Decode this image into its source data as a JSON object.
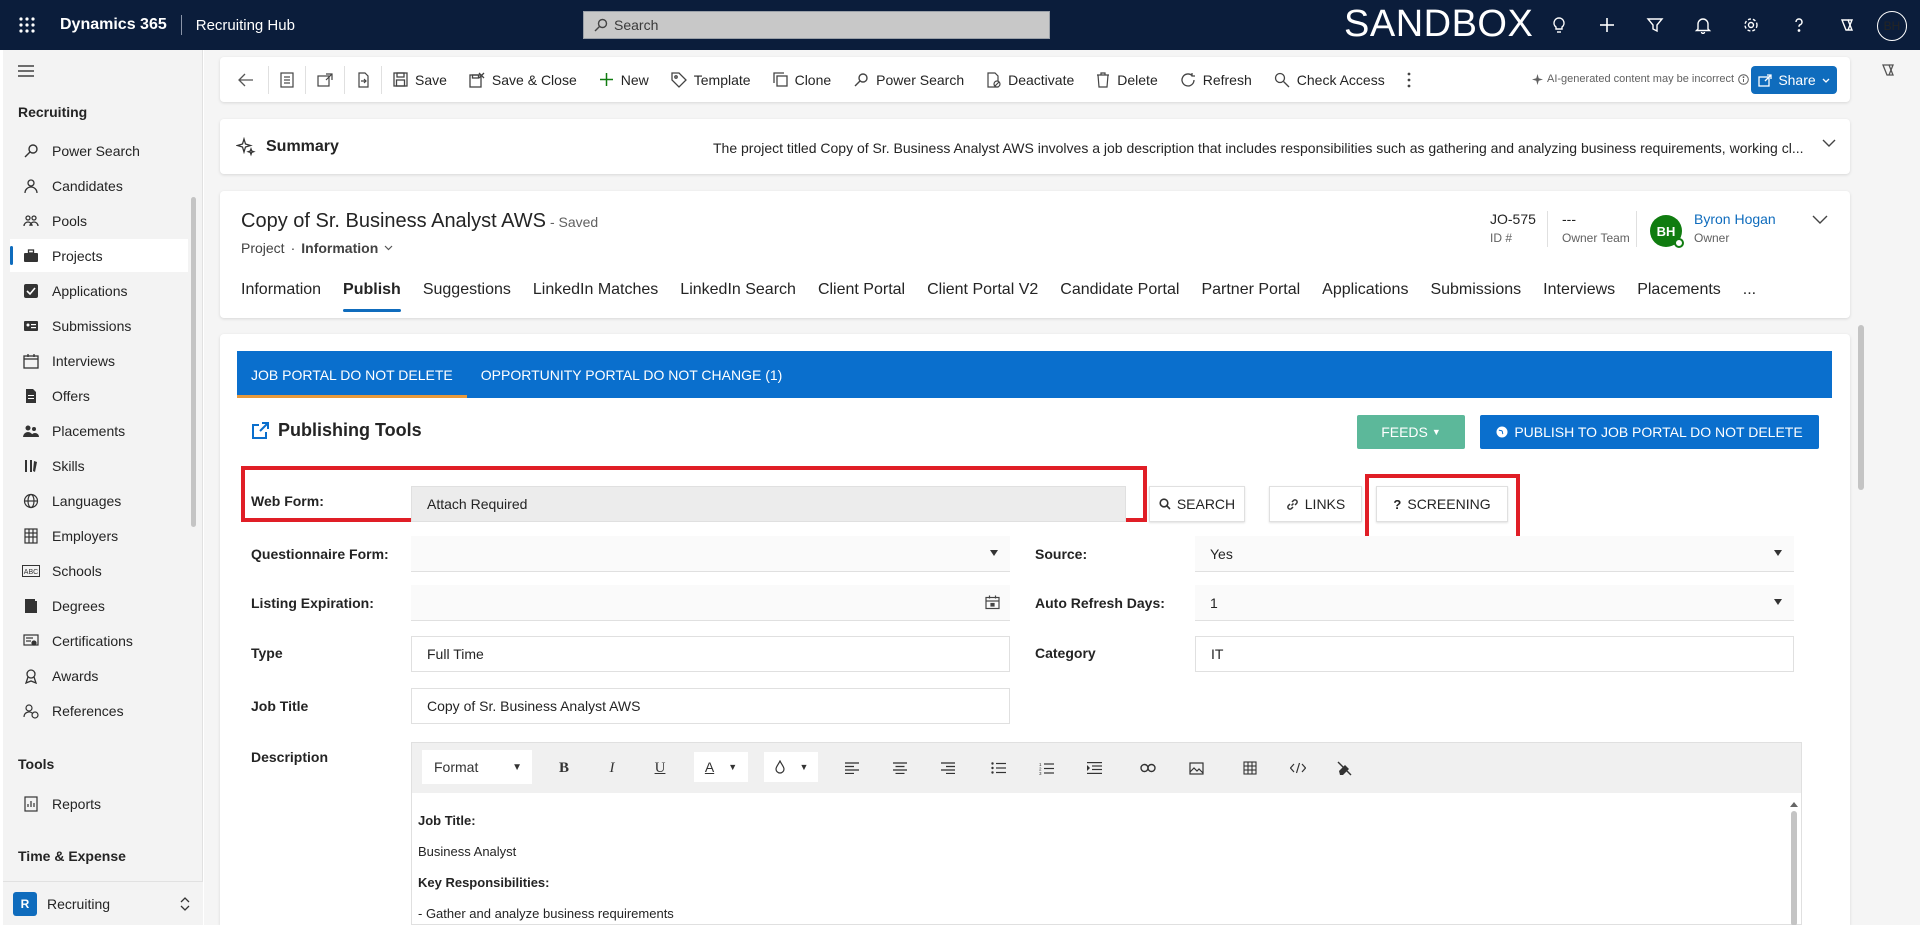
{
  "topbar": {
    "app_name": "Dynamics 365",
    "hub_name": "Recruiting Hub",
    "search_placeholder": "Search",
    "environment_banner": "SANDBOX",
    "user_initials": "BH"
  },
  "sidebar": {
    "section_recruiting": "Recruiting",
    "items": [
      {
        "label": "Power Search",
        "icon": "power-search-icon"
      },
      {
        "label": "Candidates",
        "icon": "person-icon"
      },
      {
        "label": "Pools",
        "icon": "people-group-icon"
      },
      {
        "label": "Projects",
        "icon": "briefcase-icon",
        "active": true
      },
      {
        "label": "Applications",
        "icon": "checkbox-icon"
      },
      {
        "label": "Submissions",
        "icon": "id-card-icon"
      },
      {
        "label": "Interviews",
        "icon": "calendar-icon"
      },
      {
        "label": "Offers",
        "icon": "document-icon"
      },
      {
        "label": "Placements",
        "icon": "people-icon"
      },
      {
        "label": "Skills",
        "icon": "skills-icon"
      },
      {
        "label": "Languages",
        "icon": "globe-icon"
      },
      {
        "label": "Employers",
        "icon": "building-icon"
      },
      {
        "label": "Schools",
        "icon": "abc-icon"
      },
      {
        "label": "Degrees",
        "icon": "book-icon"
      },
      {
        "label": "Certifications",
        "icon": "certificate-icon"
      },
      {
        "label": "Awards",
        "icon": "award-icon"
      },
      {
        "label": "References",
        "icon": "references-icon"
      }
    ],
    "section_tools": "Tools",
    "tools_items": [
      {
        "label": "Reports",
        "icon": "report-icon"
      }
    ],
    "section_time": "Time & Expense",
    "area_badge": "R",
    "area_label": "Recruiting"
  },
  "commandbar": {
    "save": "Save",
    "save_close": "Save & Close",
    "new": "New",
    "template": "Template",
    "clone": "Clone",
    "power_search": "Power Search",
    "deactivate": "Deactivate",
    "delete": "Delete",
    "refresh": "Refresh",
    "check_access": "Check Access",
    "ai_note": "AI-generated content may be incorrect",
    "share": "Share"
  },
  "summary": {
    "title": "Summary",
    "text": "The project titled Copy of Sr. Business Analyst AWS involves a job description that includes responsibilities such as gathering and analyzing business requirements, working cl..."
  },
  "record": {
    "title": "Copy of Sr. Business Analyst AWS",
    "status": "- Saved",
    "entity": "Project",
    "form": "Information",
    "id_value": "JO-575",
    "id_label": "ID #",
    "owner_team_value": "---",
    "owner_team_label": "Owner Team",
    "owner_initials": "BH",
    "owner_name": "Byron Hogan",
    "owner_label": "Owner",
    "tabs": [
      "Information",
      "Publish",
      "Suggestions",
      "LinkedIn Matches",
      "LinkedIn Search",
      "Client Portal",
      "Client Portal V2",
      "Candidate Portal",
      "Partner Portal",
      "Applications",
      "Submissions",
      "Interviews",
      "Placements",
      "..."
    ],
    "active_tab": "Publish"
  },
  "publish": {
    "portal_tabs": [
      "JOB PORTAL DO NOT DELETE",
      "OPPORTUNITY PORTAL DO NOT CHANGE (1)"
    ],
    "tools_title": "Publishing Tools",
    "feeds_btn": "FEEDS",
    "publish_btn": "PUBLISH TO JOB PORTAL DO NOT DELETE",
    "web_form_label": "Web Form:",
    "web_form_value": "Attach Required",
    "search_btn": "SEARCH",
    "links_btn": "LINKS",
    "screening_btn": "SCREENING",
    "questionnaire_label": "Questionnaire Form:",
    "questionnaire_value": "",
    "source_label": "Source:",
    "source_value": "Yes",
    "listing_exp_label": "Listing Expiration:",
    "listing_exp_value": "",
    "auto_refresh_label": "Auto Refresh Days:",
    "auto_refresh_value": "1",
    "type_label": "Type",
    "type_value": "Full Time",
    "category_label": "Category",
    "category_value": "IT",
    "job_title_label": "Job Title",
    "job_title_value": "Copy of Sr. Business Analyst AWS",
    "description_label": "Description",
    "editor_format": "Format",
    "editor_lines": [
      {
        "text": "Job Title:",
        "bold": true
      },
      {
        "text": "Business Analyst",
        "bold": false
      },
      {
        "text": "Key Responsibilities:",
        "bold": true
      },
      {
        "text": "- Gather and analyze business requirements",
        "bold": false
      }
    ]
  },
  "colors": {
    "topbar": "#0b1d3b",
    "accent": "#0f6cbd",
    "portal_bar": "#0a6fcd",
    "feeds": "#5cb89a",
    "highlight_box": "#e01e26"
  }
}
